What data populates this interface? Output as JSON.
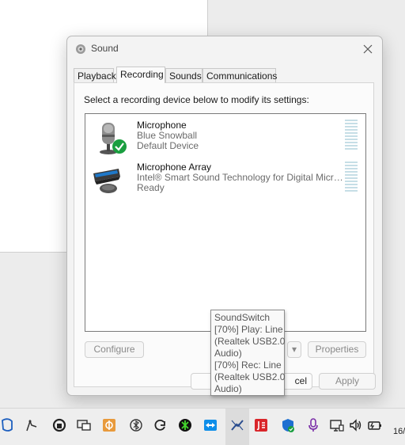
{
  "dialog": {
    "title": "Sound",
    "tabs": [
      {
        "label": "Playback"
      },
      {
        "label": "Recording"
      },
      {
        "label": "Sounds"
      },
      {
        "label": "Communications"
      }
    ],
    "instruction": "Select a recording device below to modify its settings:",
    "devices": [
      {
        "name": "Microphone",
        "description": "Blue Snowball",
        "status": "Default Device",
        "icon": "microphone-icon",
        "is_default": true
      },
      {
        "name": "Microphone Array",
        "description": "Intel® Smart Sound Technology for Digital Micro...",
        "status": "Ready",
        "icon": "microphone-array-icon",
        "is_default": false
      }
    ],
    "buttons": {
      "configure": "Configure",
      "set_default_arrow": "▾",
      "properties": "Properties",
      "ok": "",
      "cancel": "cel",
      "apply": "Apply"
    }
  },
  "tooltip": {
    "lines": [
      "SoundSwitch",
      "[70%] Play: Line",
      "(Realtek USB2.0",
      "Audio)",
      "[70%] Rec: Line",
      "(Realtek USB2.0",
      "Audio)"
    ]
  },
  "taskbar": {
    "icons": [
      "copilot-icon",
      "pen-icon",
      "security-icon",
      "remote-icon",
      "vpn-icon",
      "bluetooth-icon",
      "sync-icon",
      "razer-icon",
      "teamviewer-icon",
      "soundswitch-icon",
      "adobe-icon",
      "defender-icon",
      "microphone-icon",
      "display-icon",
      "volume-icon",
      "battery-icon"
    ],
    "clock_partial": "16/"
  },
  "colors": {
    "accent_check": "#1a9e3f",
    "meter": "#c6dee6"
  }
}
